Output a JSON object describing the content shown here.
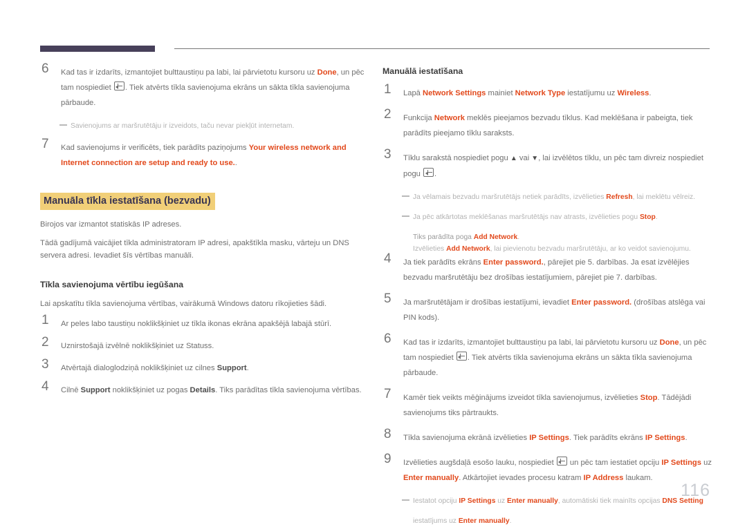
{
  "page": {
    "number": "116"
  },
  "left_column": {
    "steps_top": [
      {
        "num": "6",
        "parts": [
          {
            "t": "Kad tas ir izdarīts, izmantojiet bulttaustiņu pa labi, lai pārvietotu kursoru uz ",
            "s": "n"
          },
          {
            "t": "Done",
            "s": "b"
          },
          {
            "t": ", un pēc tam nospiediet ",
            "s": "n"
          },
          {
            "t": "",
            "s": "key"
          },
          {
            "t": ". Tiek atvērts tīkla savienojuma ekrāns un sākta tīkla savienojuma pārbaude.",
            "s": "n"
          }
        ]
      }
    ],
    "note_after_6": [
      {
        "t": "Savienojums ar maršrutētāju ir izveidots, taču nevar piekļūt internetam.",
        "s": "n"
      }
    ],
    "steps_top2": [
      {
        "num": "7",
        "parts": [
          {
            "t": "Kad savienojums ir verificēts, tiek parādīts paziņojums ",
            "s": "n"
          },
          {
            "t": "Your wireless network and Internet connection are setup and ready to use.",
            "s": "b"
          },
          {
            "t": ".",
            "s": "n"
          }
        ]
      }
    ],
    "section_title": "Manuāla tīkla iestatīšana (bezvadu)",
    "paragraphs": [
      "Birojos var izmantot statiskās IP adreses.",
      "Tādā gadījumā vaicājiet tīkla administratoram IP adresi, apakštīkla masku, vārteju un DNS servera adresi. Ievadiet šīs vērtības manuāli."
    ],
    "sub_title": "Tīkla savienojuma vērtību iegūšana",
    "intro": "Lai apskatītu tīkla savienojuma vērtības, vairākumā Windows datoru rīkojieties šādi.",
    "steps": [
      {
        "num": "1",
        "parts": [
          {
            "t": "Ar peles labo taustiņu noklikšķiniet uz tīkla ikonas ekrāna apakšējā labajā stūrī.",
            "s": "n"
          }
        ]
      },
      {
        "num": "2",
        "parts": [
          {
            "t": "Uznirstošajā izvēlnē noklikšķiniet uz Statuss.",
            "s": "n"
          }
        ]
      },
      {
        "num": "3",
        "parts": [
          {
            "t": "Atvērtajā dialoglodziņā noklikšķiniet uz cilnes ",
            "s": "n"
          },
          {
            "t": "Support",
            "s": "d"
          },
          {
            "t": ".",
            "s": "n"
          }
        ]
      },
      {
        "num": "4",
        "parts": [
          {
            "t": "Cilnē ",
            "s": "n"
          },
          {
            "t": "Support",
            "s": "d"
          },
          {
            "t": " noklikšķiniet uz pogas ",
            "s": "n"
          },
          {
            "t": "Details",
            "s": "d"
          },
          {
            "t": ". Tiks parādītas tīkla savienojuma vērtības.",
            "s": "n"
          }
        ]
      }
    ]
  },
  "right_column": {
    "sub_title": "Manuālā iestatīšana",
    "steps": [
      {
        "num": "1",
        "parts": [
          {
            "t": "Lapā ",
            "s": "n"
          },
          {
            "t": "Network Settings",
            "s": "b"
          },
          {
            "t": " mainiet ",
            "s": "n"
          },
          {
            "t": "Network Type",
            "s": "b"
          },
          {
            "t": " iestatījumu uz ",
            "s": "n"
          },
          {
            "t": "Wireless",
            "s": "b"
          },
          {
            "t": ".",
            "s": "n"
          }
        ]
      },
      {
        "num": "2",
        "parts": [
          {
            "t": "Funkcija ",
            "s": "n"
          },
          {
            "t": "Network",
            "s": "b"
          },
          {
            "t": " meklēs pieejamos bezvadu tīklus. Kad meklēšana ir pabeigta, tiek parādīts pieejamo tīklu saraksts.",
            "s": "n"
          }
        ]
      },
      {
        "num": "3",
        "parts": [
          {
            "t": "Tīklu sarakstā nospiediet pogu ",
            "s": "n"
          },
          {
            "t": "▲",
            "s": "tri"
          },
          {
            "t": " vai ",
            "s": "n"
          },
          {
            "t": "▼",
            "s": "tri"
          },
          {
            "t": ", lai izvēlētos tīklu, un pēc tam divreiz nospiediet pogu ",
            "s": "n"
          },
          {
            "t": "",
            "s": "key"
          },
          {
            "t": ".",
            "s": "n"
          }
        ]
      }
    ],
    "notes_after_3": [
      {
        "lines": [
          [
            {
              "t": "Ja vēlamais bezvadu maršrutētājs netiek parādīts, izvēlieties ",
              "s": "n"
            },
            {
              "t": "Refresh",
              "s": "b"
            },
            {
              "t": ", lai meklētu vēlreiz.",
              "s": "n"
            }
          ]
        ]
      },
      {
        "lines": [
          [
            {
              "t": "Ja pēc atkārtotas meklēšanas maršrutētājs nav atrasts, izvēlieties pogu ",
              "s": "n"
            },
            {
              "t": "Stop",
              "s": "b"
            },
            {
              "t": ".",
              "s": "n"
            }
          ],
          [
            {
              "t": "Tiks parādīta poga ",
              "s": "g"
            },
            {
              "t": "Add Network",
              "s": "b"
            },
            {
              "t": ".",
              "s": "n"
            }
          ],
          [
            {
              "t": "Izvēlieties ",
              "s": "n"
            },
            {
              "t": "Add Network",
              "s": "b"
            },
            {
              "t": ", lai pievienotu bezvadu maršrutētāju, ar ko veidot savienojumu.",
              "s": "n"
            }
          ]
        ]
      }
    ],
    "steps2": [
      {
        "num": "4",
        "parts": [
          {
            "t": "Ja tiek parādīts ekrāns ",
            "s": "n"
          },
          {
            "t": "Enter password.",
            "s": "b"
          },
          {
            "t": ", pārejiet pie 5. darbības. Ja esat izvēlējies bezvadu maršrutētāju bez drošības iestatījumiem, pārejiet pie 7. darbības.",
            "s": "n"
          }
        ]
      },
      {
        "num": "5",
        "parts": [
          {
            "t": "Ja maršrutētājam ir drošības iestatījumi, ievadiet ",
            "s": "n"
          },
          {
            "t": "Enter password.",
            "s": "b"
          },
          {
            "t": " (drošības atslēga vai PIN kods).",
            "s": "n"
          }
        ]
      },
      {
        "num": "6",
        "parts": [
          {
            "t": "Kad tas ir izdarīts, izmantojiet bulttaustiņu pa labi, lai pārvietotu kursoru uz ",
            "s": "n"
          },
          {
            "t": "Done",
            "s": "b"
          },
          {
            "t": ", un pēc tam nospiediet ",
            "s": "n"
          },
          {
            "t": "",
            "s": "key"
          },
          {
            "t": ". Tiek atvērts tīkla savienojuma ekrāns un sākta tīkla savienojuma pārbaude.",
            "s": "n"
          }
        ]
      },
      {
        "num": "7",
        "parts": [
          {
            "t": "Kamēr tiek veikts mēģinājums izveidot tīkla savienojumus, izvēlieties ",
            "s": "n"
          },
          {
            "t": "Stop",
            "s": "b"
          },
          {
            "t": ". Tādējādi savienojums tiks pārtraukts.",
            "s": "n"
          }
        ]
      },
      {
        "num": "8",
        "parts": [
          {
            "t": "Tīkla savienojuma ekrānā izvēlieties ",
            "s": "n"
          },
          {
            "t": "IP Settings",
            "s": "b"
          },
          {
            "t": ". Tiek parādīts ekrāns ",
            "s": "n"
          },
          {
            "t": "IP Settings",
            "s": "b"
          },
          {
            "t": ".",
            "s": "n"
          }
        ]
      },
      {
        "num": "9",
        "parts": [
          {
            "t": "Izvēlieties augšdaļā esošo lauku, nospiediet ",
            "s": "n"
          },
          {
            "t": "",
            "s": "key"
          },
          {
            "t": " un pēc tam iestatiet opciju ",
            "s": "n"
          },
          {
            "t": "IP Settings",
            "s": "b"
          },
          {
            "t": " uz ",
            "s": "n"
          },
          {
            "t": "Enter manually",
            "s": "b"
          },
          {
            "t": ". Atkārtojiet ievades procesu katram ",
            "s": "n"
          },
          {
            "t": "IP Address",
            "s": "b"
          },
          {
            "t": " laukam.",
            "s": "n"
          }
        ]
      }
    ],
    "notes_after_9": [
      {
        "lines": [
          [
            {
              "t": "Iestatot opciju ",
              "s": "n"
            },
            {
              "t": "IP Settings",
              "s": "b"
            },
            {
              "t": " uz ",
              "s": "n"
            },
            {
              "t": "Enter manually",
              "s": "b"
            },
            {
              "t": ", automātiski tiek mainīts opcijas ",
              "s": "n"
            },
            {
              "t": "DNS Setting",
              "s": "b"
            },
            {
              "t": "",
              "s": "n"
            }
          ],
          [
            {
              "t": "iestatījums uz ",
              "s": "n"
            },
            {
              "t": "Enter manually",
              "s": "b"
            },
            {
              "t": ".",
              "s": "n"
            }
          ]
        ]
      }
    ]
  },
  "colors": {
    "accent": "#e2491c",
    "header_bar": "#47405a",
    "highlight": "#f1cf78",
    "highlight_text": "#3a3551",
    "body_text": "#6f6f6f",
    "note_text": "#b2b2b2",
    "page_number": "#c9ccd1"
  }
}
